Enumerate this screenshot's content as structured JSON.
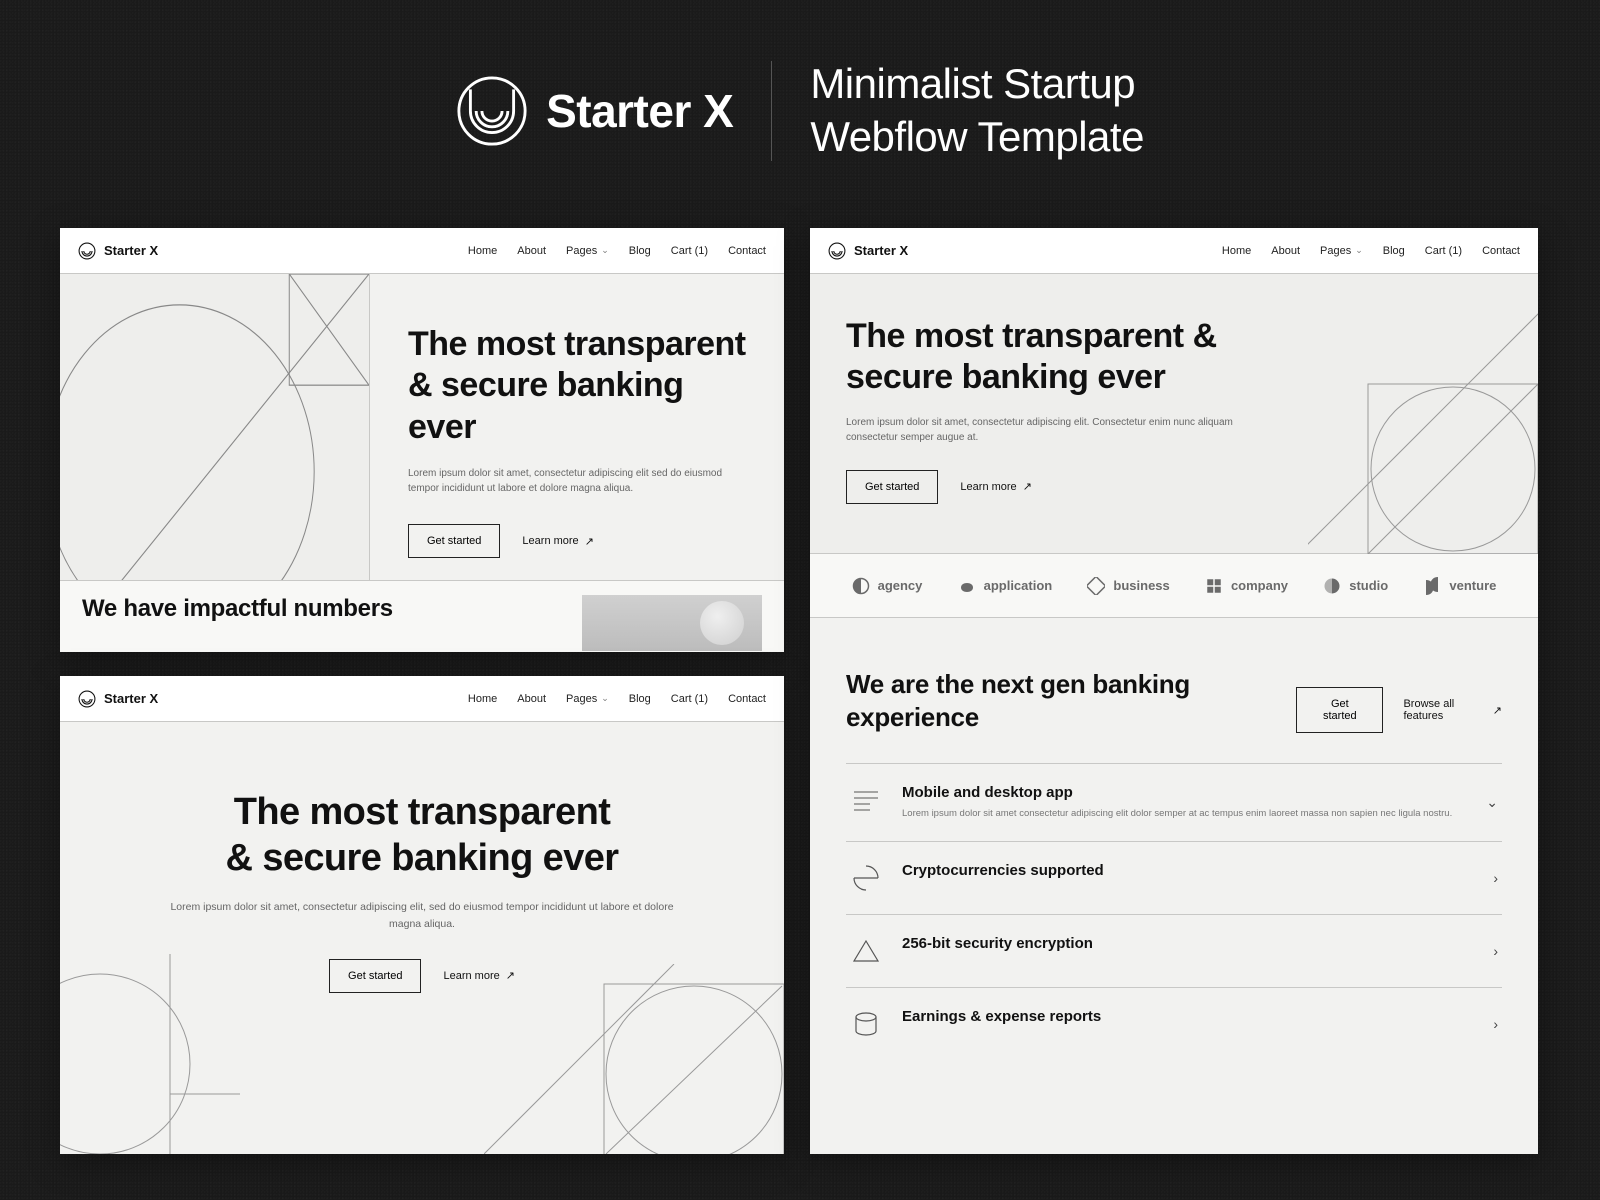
{
  "hero": {
    "brand": "Starter X",
    "title_line1": "Minimalist Startup",
    "title_line2": "Webflow Template"
  },
  "nav": {
    "brand": "Starter X",
    "items": [
      "Home",
      "About",
      "Pages",
      "Blog",
      "Cart (1)",
      "Contact"
    ]
  },
  "cardA": {
    "headline": "The most transparent & secure banking ever",
    "lorem": "Lorem ipsum dolor sit amet, consectetur adipiscing elit sed do eiusmod tempor incididunt ut labore et dolore magna aliqua.",
    "cta": "Get started",
    "link": "Learn more",
    "section2": "We have impactful numbers"
  },
  "cardC": {
    "headline_l1": "The most transparent",
    "headline_l2": "& secure banking ever",
    "lorem": "Lorem ipsum dolor sit amet, consectetur adipiscing elit, sed do eiusmod tempor incididunt ut labore et dolore magna aliqua.",
    "cta": "Get started",
    "link": "Learn more"
  },
  "cardB": {
    "headline": "The most transparent & secure banking ever",
    "lorem": "Lorem ipsum dolor sit amet, consectetur adipiscing elit. Consectetur enim nunc aliquam consectetur semper augue at.",
    "cta": "Get started",
    "link": "Learn more",
    "logos": [
      "agency",
      "application",
      "business",
      "company",
      "studio",
      "venture"
    ],
    "section3_h": "We are the next gen banking experience",
    "section3_cta": "Get started",
    "section3_link": "Browse all features",
    "features": [
      {
        "title": "Mobile and desktop app",
        "desc": "Lorem ipsum dolor sit amet consectetur adipiscing elit dolor semper at ac tempus enim laoreet massa non sapien nec ligula nostru."
      },
      {
        "title": "Cryptocurrencies supported",
        "desc": ""
      },
      {
        "title": "256-bit security encryption",
        "desc": ""
      },
      {
        "title": "Earnings & expense reports",
        "desc": ""
      }
    ]
  }
}
